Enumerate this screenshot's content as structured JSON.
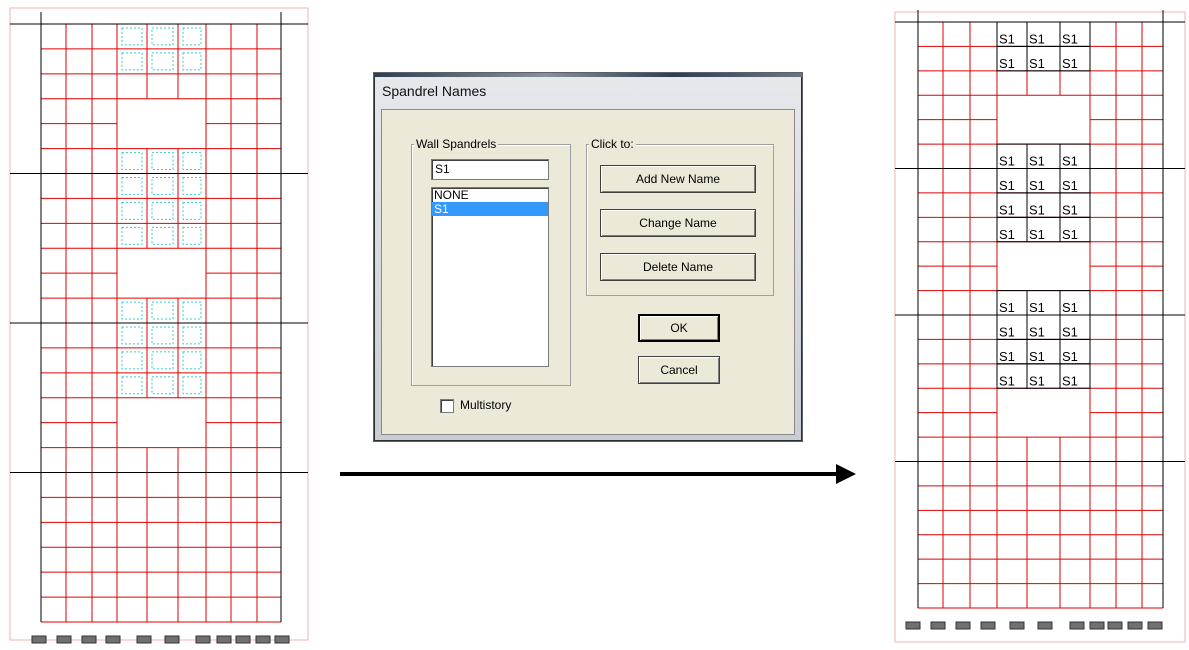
{
  "dialog": {
    "title": "Spandrel Names",
    "wall_spandrels_label": "Wall Spandrels",
    "name_input_value": "S1",
    "list_items": [
      "NONE",
      "S1"
    ],
    "selected_item": "S1",
    "click_to_label": "Click to:",
    "add_new_name_label": "Add New Name",
    "change_name_label": "Change Name",
    "delete_name_label": "Delete Name",
    "ok_label": "OK",
    "cancel_label": "Cancel",
    "multistory_label": "Multistory",
    "multistory_checked": false
  },
  "result_grid": {
    "spandrel_label": "S1"
  },
  "colors": {
    "grid_line": "#e00000",
    "story_line": "#000000",
    "panel_border": "#f0b0b0",
    "spandrel_marker": "#33cccc",
    "support": "#707070",
    "selection": "#3399ff"
  }
}
